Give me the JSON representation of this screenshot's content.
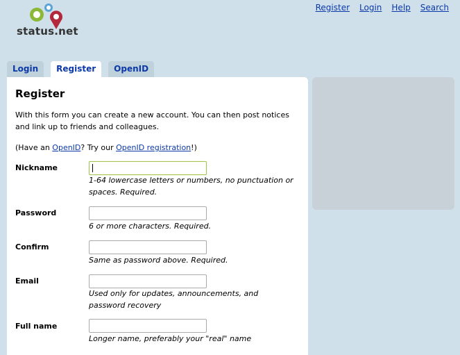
{
  "logo": {
    "text": "status.net"
  },
  "topnav": [
    "Register",
    "Login",
    "Help",
    "Search"
  ],
  "tabs": [
    {
      "label": "Login"
    },
    {
      "label": "Register"
    },
    {
      "label": "OpenID"
    }
  ],
  "page": {
    "title": "Register",
    "intro": "With this form you can create a new account. You can then post notices and link up to friends and colleagues.",
    "openid_prefix": "(Have an ",
    "openid_link": "OpenID",
    "openid_mid": "? Try our ",
    "openid_reg_link": "OpenID registration",
    "openid_suffix": "!)"
  },
  "form": {
    "nickname": {
      "label": "Nickname",
      "value": "",
      "hint": "1-64 lowercase letters or numbers, no punctuation or spaces. Required."
    },
    "password": {
      "label": "Password",
      "value": "",
      "hint": "6 or more characters. Required."
    },
    "confirm": {
      "label": "Confirm",
      "value": "",
      "hint": "Same as password above. Required."
    },
    "email": {
      "label": "Email",
      "value": "",
      "hint": "Used only for updates, announcements, and password recovery"
    },
    "fullname": {
      "label": "Full name",
      "value": "",
      "hint": "Longer name, preferably your \"real\" name"
    }
  },
  "colors": {
    "link": "#0b39a8",
    "background": "#cfe0ea",
    "focus_border": "#a3c54f"
  },
  "icons": [
    "status-net-logo-icon"
  ]
}
